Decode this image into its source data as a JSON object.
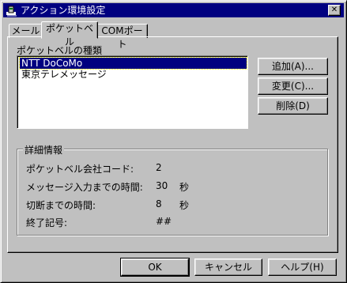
{
  "window": {
    "title": "アクション環境設定",
    "close_glyph": "✕"
  },
  "tabs": [
    {
      "label": "メール"
    },
    {
      "label": "ポケットベル"
    },
    {
      "label": "COMポート"
    }
  ],
  "pager_types": {
    "label": "ポケットベルの種類",
    "items": [
      "NTT DoCoMo",
      "東京テレメッセージ"
    ],
    "selected_index": 0
  },
  "side_buttons": {
    "add": "追加(A)...",
    "change": "変更(C)...",
    "delete": "削除(D)"
  },
  "details": {
    "group_label": "詳細情報",
    "rows": [
      {
        "label": "ポケットベル会社コード:",
        "value": "2",
        "unit": ""
      },
      {
        "label": "メッセージ入力までの時間:",
        "value": "30",
        "unit": "秒"
      },
      {
        "label": "切断までの時間:",
        "value": "8",
        "unit": "秒"
      },
      {
        "label": "終了記号:",
        "value": "##",
        "unit": ""
      }
    ]
  },
  "bottom_buttons": {
    "ok": "OK",
    "cancel": "キャンセル",
    "help": "ヘルプ(H)"
  },
  "icons": {
    "app": "phone-settings-icon",
    "close": "close-icon"
  },
  "colors": {
    "titlebar": "#000080",
    "face": "#c0c0c0",
    "selection": "#000080"
  }
}
